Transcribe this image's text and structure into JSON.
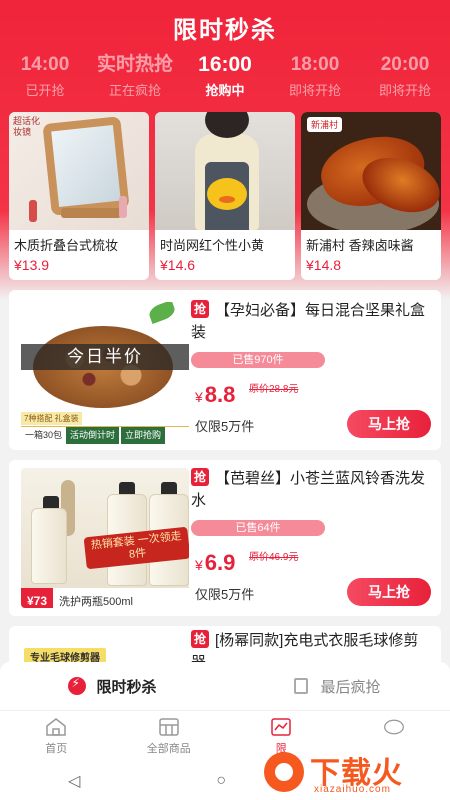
{
  "header": {
    "title": "限时秒杀"
  },
  "timeslots": [
    {
      "time": "14:00",
      "status": "已开抢"
    },
    {
      "time": "实时热抢",
      "status": "正在疯抢"
    },
    {
      "time": "16:00",
      "status": "抢购中"
    },
    {
      "time": "18:00",
      "status": "即将开抢"
    },
    {
      "time": "20:00",
      "status": "即将开抢"
    }
  ],
  "top_products": [
    {
      "name": "木质折叠台式梳妆",
      "price": "¥13.9",
      "image_tag": "超话化妆镜"
    },
    {
      "name": "时尚网红个性小黄",
      "price": "¥14.6"
    },
    {
      "name": "新浦村 香辣卤味酱",
      "price": "¥14.8",
      "image_tag": "新浦村"
    }
  ],
  "products": [
    {
      "tag": "抢",
      "title": "【孕妇必备】每日混合坚果礼盒装",
      "sold": "已售970件",
      "currency": "¥",
      "price": "8.8",
      "original": "原价28.8元",
      "limit": "仅限5万件",
      "buy_label": "马上抢",
      "image_text": "今日半价",
      "image_tag": "7种搭配 礼盒装",
      "image_strip_a": "一箱30包",
      "image_strip_b": "活动倒计时",
      "image_strip_c": "立即抢购"
    },
    {
      "tag": "抢",
      "title": "【芭碧丝】小苍兰蓝风铃香洗发水",
      "sold": "已售64件",
      "currency": "¥",
      "price": "6.9",
      "original": "原价46.9元",
      "limit": "仅限5万件",
      "buy_label": "马上抢",
      "image_badge": "热销套装 一次领走8件",
      "image_price": "¥73",
      "image_desc": "洗护两瓶500ml"
    },
    {
      "tag": "抢",
      "title": "[杨幂同款]充电式衣服毛球修剪器",
      "image_tag": "专业毛球修剪器"
    }
  ],
  "tabs": [
    {
      "label": "限时秒杀",
      "active": true
    },
    {
      "label": "最后疯抢",
      "active": false
    }
  ],
  "nav": [
    {
      "label": "首页",
      "icon": "home-icon"
    },
    {
      "label": "全部商品",
      "icon": "grid-icon"
    },
    {
      "label": "限",
      "icon": "chart-icon",
      "active": true
    },
    {
      "label": "",
      "icon": "profile-icon"
    }
  ],
  "system": {
    "back": "◁",
    "home": "○"
  },
  "watermark": {
    "text": "下载火",
    "sub": "xiazaihuo.com"
  },
  "colors": {
    "accent": "#e8213a",
    "header": "#f0243a",
    "watermark": "#f5591f"
  }
}
